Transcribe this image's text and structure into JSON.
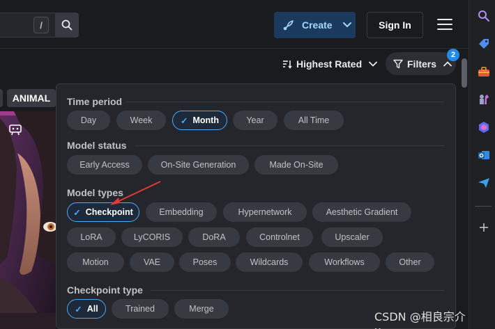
{
  "header": {
    "search_shortcut": "/",
    "create_label": "Create",
    "signin_label": "Sign In"
  },
  "toolbar": {
    "sort_label": "Highest Rated",
    "filters_label": "Filters",
    "filters_count": "2"
  },
  "chips": {
    "animal": "ANIMAL"
  },
  "filters": {
    "time_period": {
      "title": "Time period",
      "options": [
        "Day",
        "Week",
        "Month",
        "Year",
        "All Time"
      ],
      "selected": "Month"
    },
    "model_status": {
      "title": "Model status",
      "options": [
        "Early Access",
        "On-Site Generation",
        "Made On-Site"
      ]
    },
    "model_types": {
      "title": "Model types",
      "options": [
        "Checkpoint",
        "Embedding",
        "Hypernetwork",
        "Aesthetic Gradient",
        "LoRA",
        "LyCORIS",
        "DoRA",
        "Controlnet",
        "Upscaler",
        "Motion",
        "VAE",
        "Poses",
        "Wildcards",
        "Workflows",
        "Other"
      ],
      "selected": "Checkpoint"
    },
    "checkpoint_type": {
      "title": "Checkpoint type",
      "options": [
        "All",
        "Trained",
        "Merge"
      ],
      "selected": "All"
    }
  },
  "watermark": "CSDN @相良宗介x",
  "colors": {
    "accent": "#4dabf7",
    "badge": "#228be6",
    "create_bg": "#1c3a5e",
    "panel_bg": "#25262b",
    "annotation_arrow": "#e53935"
  },
  "rail_icons": [
    "search-icon",
    "tag-icon",
    "toolbox-icon",
    "chess-icon",
    "copilot-icon",
    "outlook-icon",
    "send-icon",
    "add-icon"
  ]
}
